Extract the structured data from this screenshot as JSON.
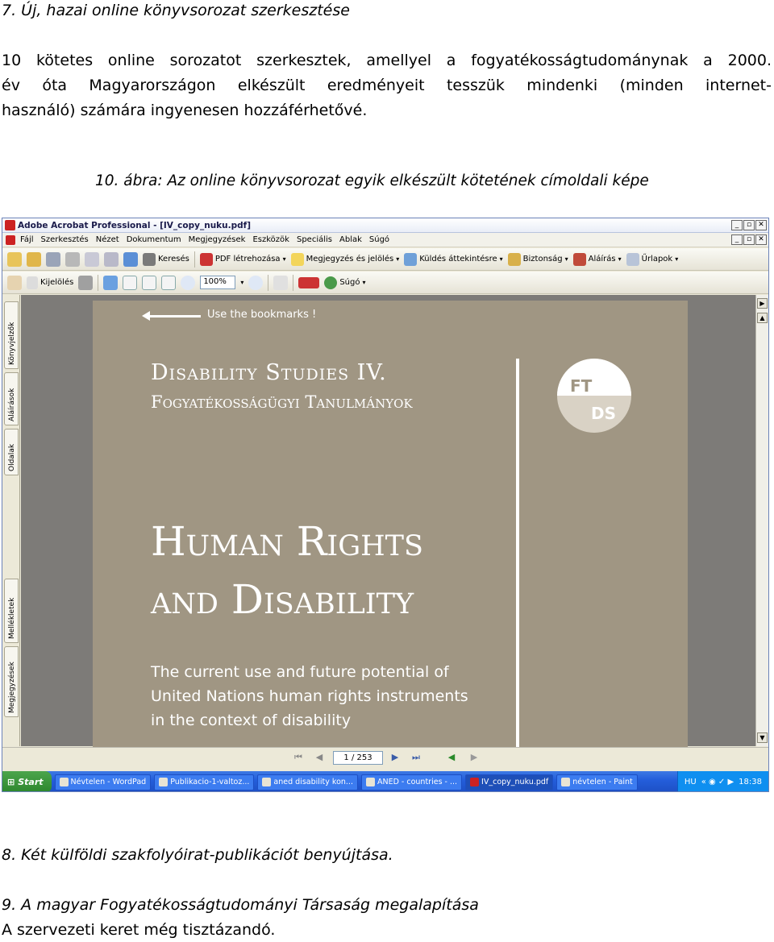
{
  "document": {
    "heading7": "7. Új, hazai online könyvsorozat szerkesztése",
    "paragraph_lines": [
      "10 kötetes online sorozatot szerkesztek, amellyel a fogyatékosságtudománynak a 2000.",
      "év óta Magyarországon elkészült eredményeit tesszük mindenki (minden internet-",
      "használó) számára ingyenesen hozzáférhetővé."
    ],
    "caption": "10. ábra: Az online könyvsorozat egyik elkészült kötetének címoldali képe",
    "heading8": "8. Két külföldi szakfolyóirat-publikációt benyújtása.",
    "heading9": "9. A magyar Fogyatékosságtudományi Társaság megalapítása",
    "line9b": "A szervezeti keret még tisztázandó."
  },
  "screenshot": {
    "window_title": "Adobe Acrobat Professional - [IV_copy_nuku.pdf]",
    "menu": [
      "Fájl",
      "Szerkesztés",
      "Nézet",
      "Dokumentum",
      "Megjegyzések",
      "Eszközök",
      "Speciális",
      "Ablak",
      "Súgó"
    ],
    "toolbar1": {
      "search": "Keresés",
      "create_pdf": "PDF létrehozása",
      "comment": "Megjegyzés és jelölés",
      "send_review": "Küldés áttekintésre",
      "security": "Biztonság",
      "sign": "Aláírás",
      "forms": "Űrlapok"
    },
    "toolbar2": {
      "select": "Kijelölés",
      "zoom": "100%",
      "help": "Súgó"
    },
    "side_tabs": [
      "Könyvjelzők",
      "Aláírások",
      "Oldalak",
      "Mellékletek",
      "Megjegyzések"
    ],
    "cover": {
      "bookmark_hint": "Use the bookmarks !",
      "series_line1": "Disability Studies IV.",
      "series_line2": "Fogyatékosságügyi Tanulmányok",
      "logo_top": "FT",
      "logo_bottom": "DS",
      "title_line1": "Human Rights",
      "title_line2": "and Disability",
      "subtitle_lines": [
        "The current use and future potential of",
        "United Nations human rights instruments",
        "in the context of disability"
      ]
    },
    "page_indicator": "1 / 253",
    "taskbar": {
      "start": "Start",
      "tasks": [
        "Névtelen - WordPad",
        "Publikacio-1-valtoz...",
        "aned disability kon...",
        "ANED - countries - ...",
        "IV_copy_nuku.pdf",
        "névtelen - Paint"
      ],
      "tray_lang": "HU",
      "clock": "18:38"
    },
    "colors": {
      "cover_bg": "#a09683",
      "taskbar": "#245edb"
    }
  }
}
